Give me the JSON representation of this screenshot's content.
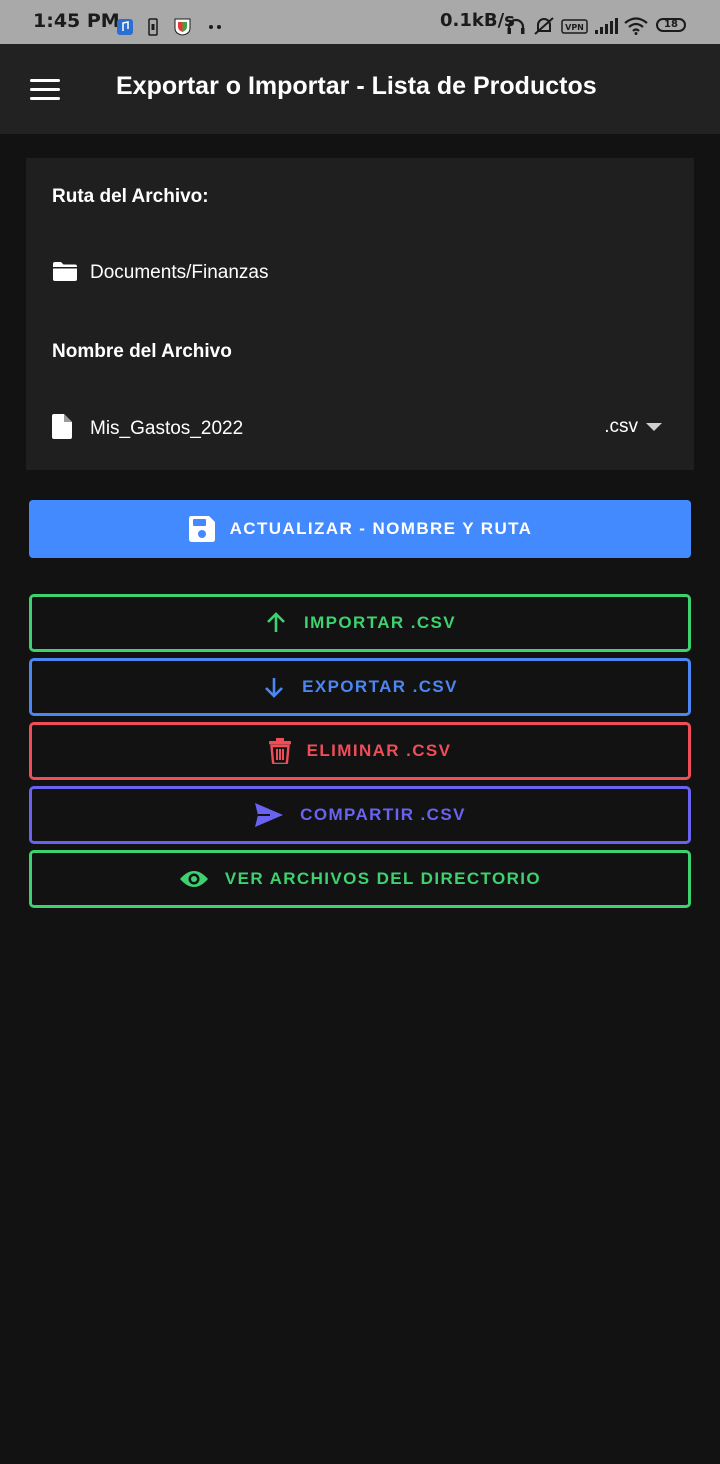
{
  "status_bar": {
    "time": "1:45 PM",
    "net_speed": "0.1kB/s",
    "battery": "18",
    "icons": [
      "music-app-icon",
      "usb-icon",
      "shield-app-icon",
      "more-dots-icon",
      "headphones-icon",
      "mute-icon",
      "vpn-icon",
      "signal-icon",
      "wifi-icon",
      "battery-icon"
    ]
  },
  "app_bar": {
    "title": "Exportar o Importar - Lista de Productos",
    "menu_icon": "menu-icon"
  },
  "file_card": {
    "path_label": "Ruta del Archivo:",
    "path_value": "Documents/Finanzas",
    "name_label": "Nombre del Archivo",
    "name_value": "Mis_Gastos_2022",
    "extension": ".csv"
  },
  "actions": {
    "update": "ACTUALIZAR - NOMBRE Y RUTA",
    "import": "IMPORTAR .CSV",
    "export": "EXPORTAR .CSV",
    "delete": "ELIMINAR .CSV",
    "share": "COMPARTIR .CSV",
    "view": "VER ARCHIVOS DEL DIRECTORIO"
  },
  "colors": {
    "primary": "#448aff",
    "import": "#3ed16f",
    "export": "#4b86f2",
    "delete": "#ef4d58",
    "share": "#6a62f0",
    "view": "#3ed16f",
    "background": "#121212",
    "card": "#1f1f1f",
    "app_bar": "#222222"
  }
}
